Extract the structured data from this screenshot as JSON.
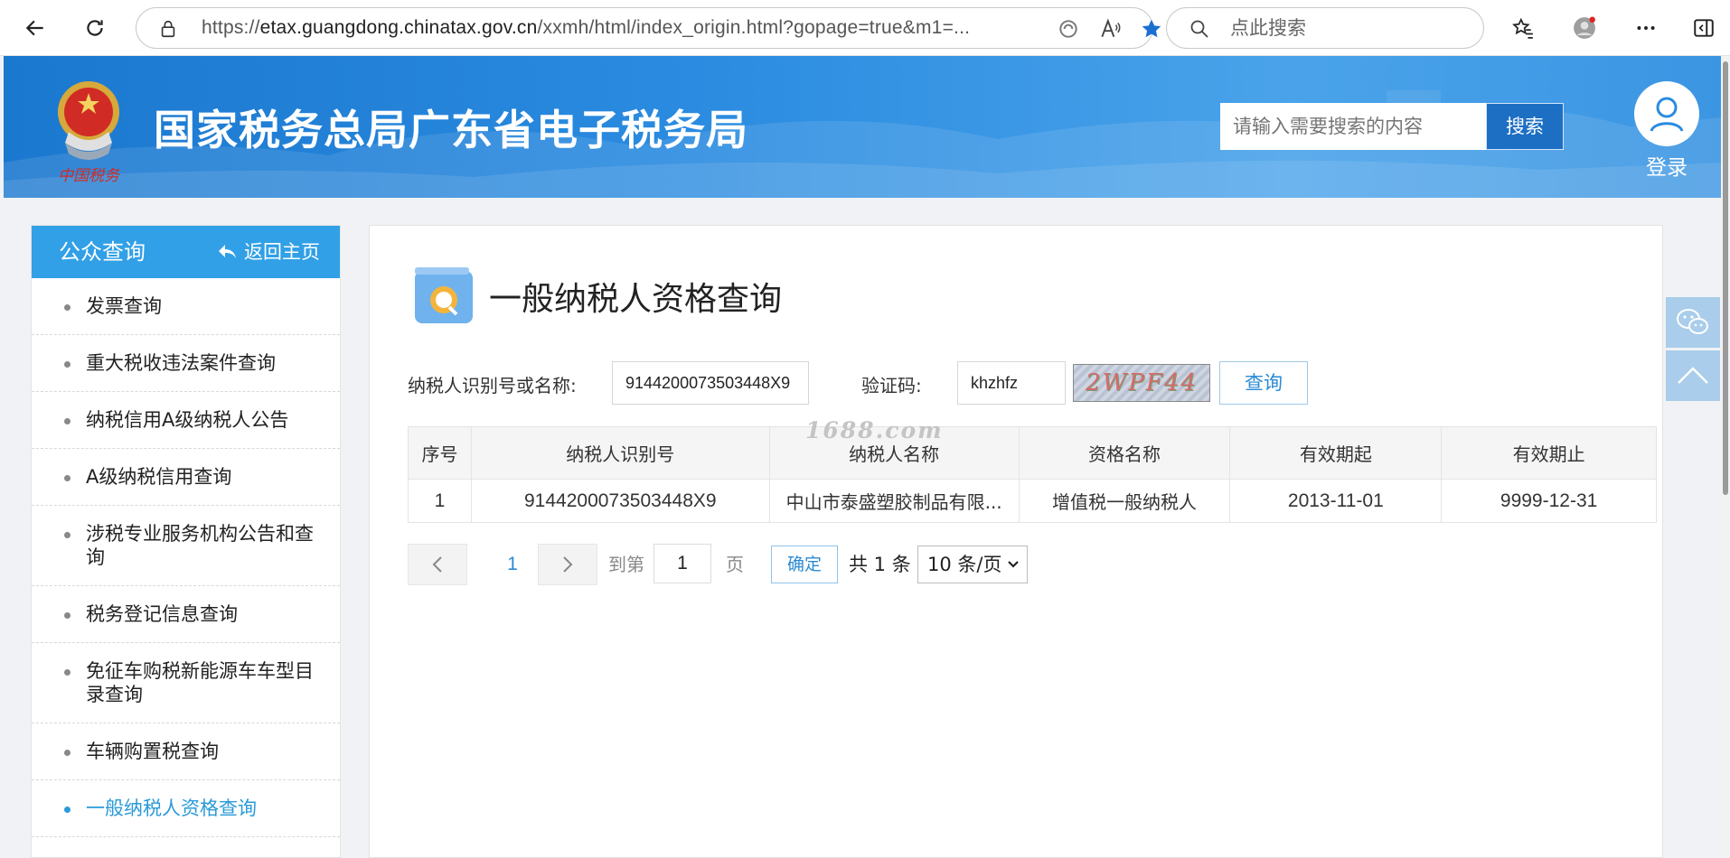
{
  "browser": {
    "url_prefix": "https://",
    "url_host": "etax.guangdong.chinatax.gov.cn",
    "url_rest": "/xxmh/html/index_origin.html?gopage=true&m1=...",
    "search_placeholder": "点此搜索",
    "icons": [
      "back-icon",
      "refresh-icon",
      "lock-icon",
      "tracking-icon",
      "read-aloud-icon",
      "favorite-star-icon",
      "search-icon",
      "favorites-icon",
      "profile-icon",
      "more-icon",
      "sidebar-icon"
    ]
  },
  "header": {
    "site_title": "国家税务总局广东省电子税务局",
    "search_placeholder": "请输入需要搜索的内容",
    "search_button": "搜索",
    "login_label": "登录",
    "emblem_text": "中国税务"
  },
  "sidebar": {
    "title": "公众查询",
    "back_label": "返回主页",
    "items": [
      {
        "label": "发票查询",
        "active": false
      },
      {
        "label": "重大税收违法案件查询",
        "active": false
      },
      {
        "label": "纳税信用A级纳税人公告",
        "active": false
      },
      {
        "label": "A级纳税信用查询",
        "active": false
      },
      {
        "label": "涉税专业服务机构公告和查询",
        "active": false
      },
      {
        "label": "税务登记信息查询",
        "active": false
      },
      {
        "label": "免征车购税新能源车车型目录查询",
        "active": false
      },
      {
        "label": "车辆购置税查询",
        "active": false
      },
      {
        "label": "一般纳税人资格查询",
        "active": true
      }
    ]
  },
  "main": {
    "title": "一般纳税人资格查询",
    "taxpayer_label": "纳税人识别号或名称:",
    "taxpayer_value": "9144200073503448X9",
    "captcha_label": "验证码:",
    "captcha_value": "khzhfz",
    "captcha_image_text": "2WPF44",
    "query_button": "查询",
    "watermark": "1688.com"
  },
  "table": {
    "columns": [
      "序号",
      "纳税人识别号",
      "纳税人名称",
      "资格名称",
      "有效期起",
      "有效期止"
    ],
    "rows": [
      [
        "1",
        "9144200073503448X9",
        "中山市泰盛塑胶制品有限...",
        "增值税一般纳税人",
        "2013-11-01",
        "9999-12-31"
      ]
    ]
  },
  "pagination": {
    "current_page": "1",
    "goto_label": "到第",
    "goto_value": "1",
    "page_unit": "页",
    "confirm_button": "确定",
    "total_text": "共 1 条",
    "page_size": "10 条/页"
  },
  "colors": {
    "header_blue": "#2a8be0",
    "sidebar_head": "#31a0e6",
    "active_link": "#2a9ad8",
    "search_button": "#1d6fc4"
  }
}
